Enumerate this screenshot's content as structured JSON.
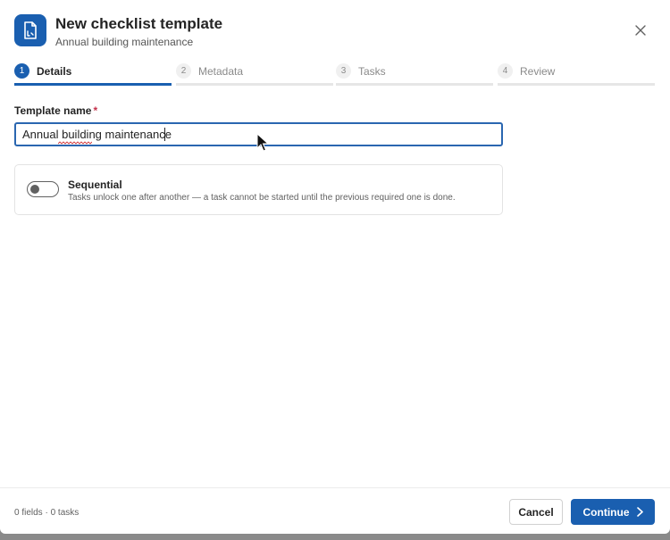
{
  "dialog": {
    "title": "New checklist template",
    "subtitle": "Annual building maintenance",
    "icon": "document-checklist-icon",
    "close_icon": "close-icon"
  },
  "steps": [
    {
      "number": "1",
      "label": "Details",
      "active": true
    },
    {
      "number": "2",
      "label": "Metadata",
      "active": false
    },
    {
      "number": "3",
      "label": "Tasks",
      "active": false
    },
    {
      "number": "4",
      "label": "Review",
      "active": false
    }
  ],
  "form": {
    "template_name_label": "Template name",
    "required_marker": "*",
    "template_name_value": "Annual building maintenance"
  },
  "sequential": {
    "title": "Sequential",
    "description": "Tasks unlock one after another — a task cannot be started until the previous required one is done.",
    "enabled": false
  },
  "footer": {
    "status": "0 fields · 0 tasks",
    "cancel_label": "Cancel",
    "continue_label": "Continue"
  },
  "colors": {
    "accent": "#1a5fb0",
    "required": "#c4314b"
  }
}
